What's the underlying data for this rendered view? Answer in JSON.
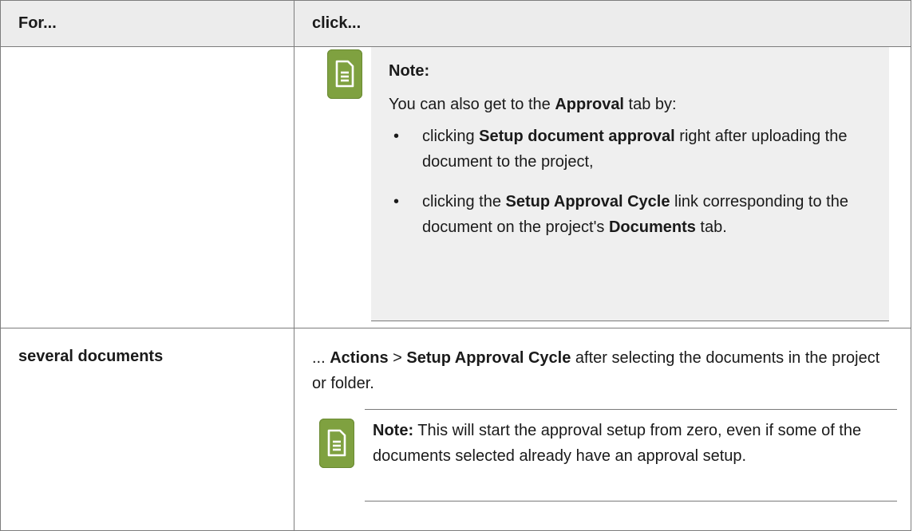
{
  "table": {
    "headers": [
      "For...",
      "click..."
    ],
    "row1": {
      "left": "",
      "note": {
        "icon": "note-icon",
        "title": "Note:",
        "intro_pre": "You can also get to the ",
        "intro_bold": "Approval",
        "intro_post": " tab by:",
        "items": [
          {
            "pre": "clicking ",
            "bold": "Setup document approval",
            "post": " right after uploading the document to the project,"
          },
          {
            "pre": "clicking the ",
            "bold": "Setup Approval Cycle",
            "post": " link corresponding to the document on the project's ",
            "bold2": "Documents",
            "post2": " tab."
          }
        ]
      }
    },
    "row2": {
      "left": "several documents",
      "lead": "... ",
      "action1": "Actions",
      "sep": " > ",
      "action2": "Setup Approval Cycle",
      "tail": " after selecting the documents in the project or folder.",
      "note": {
        "icon": "note-icon",
        "title": "Note:",
        "text": "  This will start the approval setup from zero, even if some of the documents selected already have an approval setup."
      }
    }
  },
  "colors": {
    "icon": "#7fa140",
    "note_bg": "#efefef",
    "header_bg": "#ececec"
  }
}
